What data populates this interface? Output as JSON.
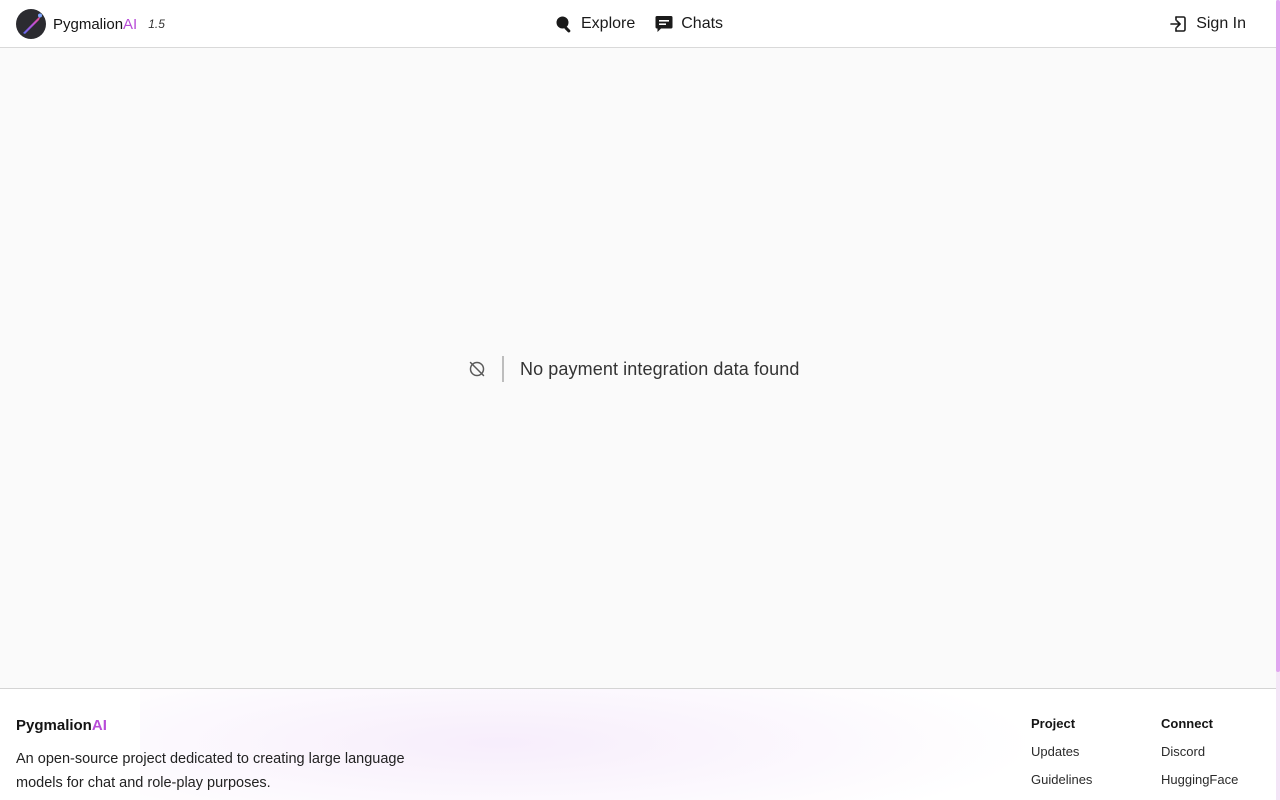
{
  "header": {
    "brand_name": "Pygmalion",
    "brand_accent": "AI",
    "version": "1.5",
    "nav": [
      {
        "label": "Explore",
        "icon": "search-icon"
      },
      {
        "label": "Chats",
        "icon": "chat-icon"
      }
    ],
    "signin_label": "Sign In"
  },
  "main": {
    "empty_icon": "no-data-icon",
    "empty_message": "No payment integration data found"
  },
  "footer": {
    "brand_name": "Pygmalion",
    "brand_accent": "AI",
    "description": "An open-source project dedicated to creating large language models for chat and role-play purposes.",
    "columns": [
      {
        "title": "Project",
        "links": [
          "Updates",
          "Guidelines"
        ]
      },
      {
        "title": "Connect",
        "links": [
          "Discord",
          "HuggingFace"
        ]
      }
    ]
  },
  "colors": {
    "accent": "#b84cd8",
    "background": "#fafafa",
    "scroll_thumb": "#e0a6ef"
  }
}
